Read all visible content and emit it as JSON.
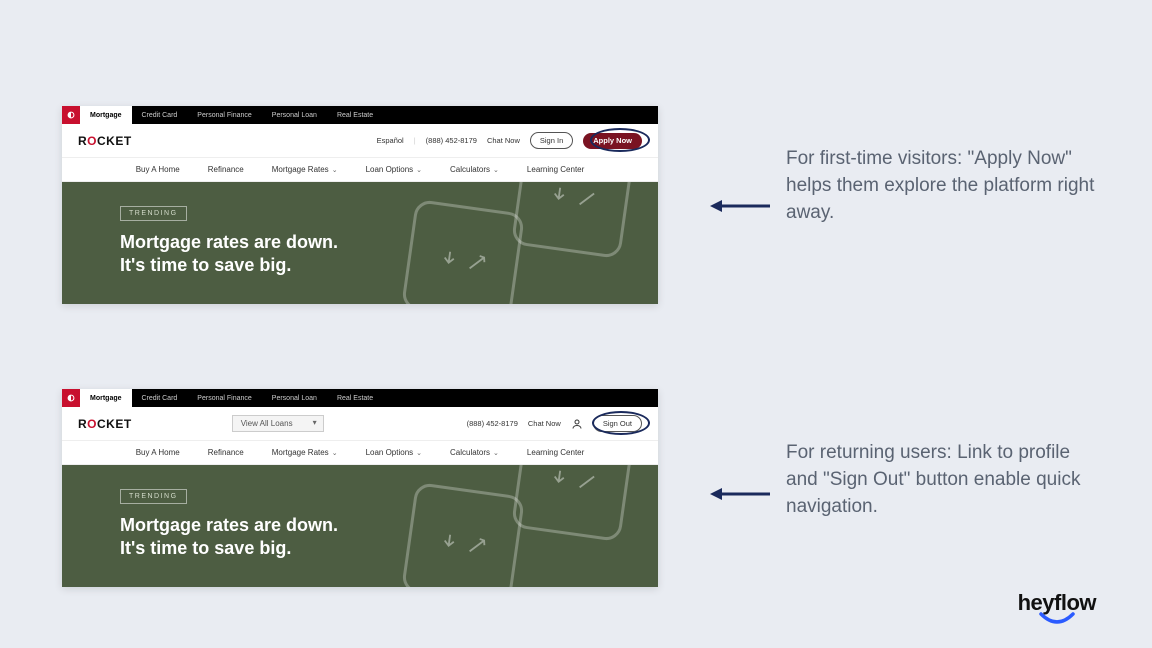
{
  "topnav": {
    "tabs": [
      "Mortgage",
      "Credit Card",
      "Personal Finance",
      "Personal Loan",
      "Real Estate"
    ]
  },
  "brand": {
    "text_pre": "R",
    "text_o": "O",
    "text_post": "CKET"
  },
  "card1_mid": {
    "espanol": "Español",
    "phone": "(888) 452-8179",
    "chat": "Chat Now",
    "signin": "Sign In",
    "apply": "Apply Now"
  },
  "card2_mid": {
    "viewall": "View All Loans",
    "phone": "(888) 452-8179",
    "chat": "Chat Now",
    "signout": "Sign Out"
  },
  "subnav": {
    "buy": "Buy A Home",
    "refi": "Refinance",
    "rates": "Mortgage Rates",
    "loans": "Loan Options",
    "calc": "Calculators",
    "learn": "Learning Center"
  },
  "hero": {
    "badge": "TRENDING",
    "line1": "Mortgage rates are down.",
    "line2": "It's time to save big."
  },
  "annotations": {
    "a1": "For first-time visitors: \"Apply Now\" helps them explore the platform right away.",
    "a2": "For returning users: Link to profile and \"Sign Out\" button enable quick navigation."
  },
  "logo": {
    "text": "heyflow"
  }
}
